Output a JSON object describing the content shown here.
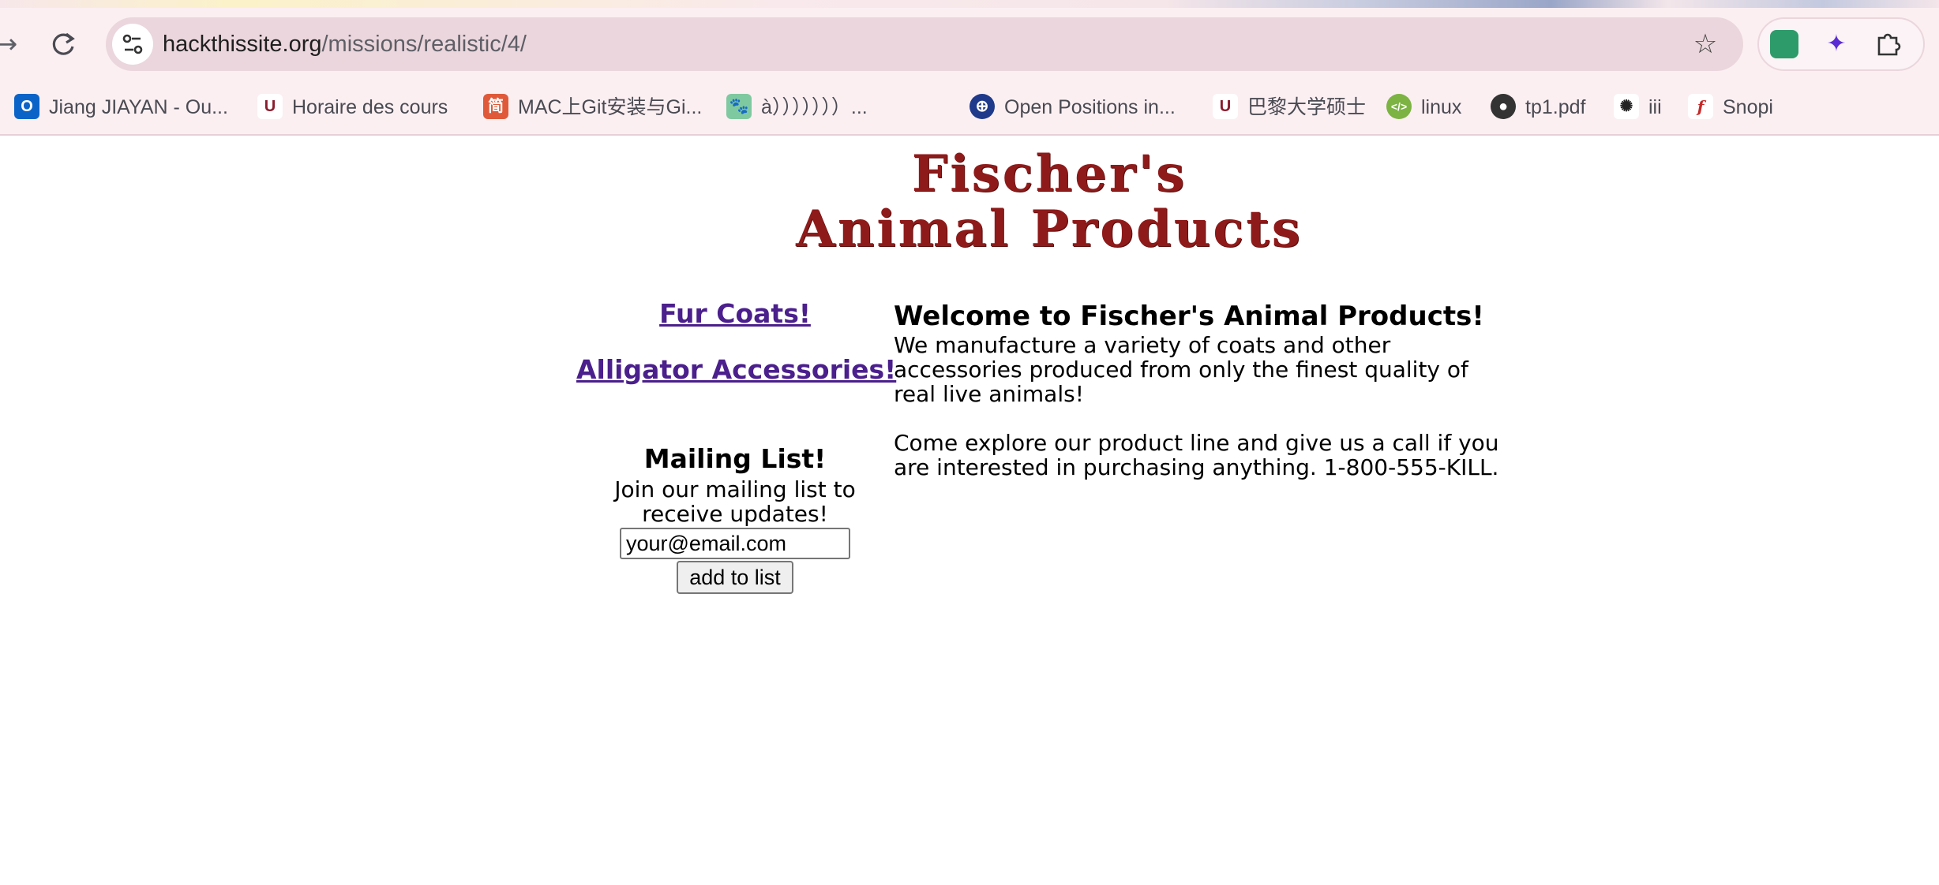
{
  "browser": {
    "url_host": "hackthissite.org",
    "url_path": "/missions/realistic/4/",
    "bookmarks": [
      {
        "label": "Jiang JIAYAN - Ou...",
        "icon": "outlook-icon",
        "color": "#0a64c8"
      },
      {
        "label": "Horaire des cours",
        "icon": "university-icon",
        "color": "#8a1c2c"
      },
      {
        "label": "MAC上Git安装与Gi...",
        "icon": "jianshu-icon",
        "color": "#e05a3a"
      },
      {
        "label": "à）））））））...",
        "icon": "paw-icon",
        "color": "#4caf7a"
      },
      {
        "label": "Open Positions in...",
        "icon": "globe-grid-icon",
        "color": "#1f3a8a"
      },
      {
        "label": "巴黎大学硕士",
        "icon": "university-icon",
        "color": "#8a1c2c"
      },
      {
        "label": "linux",
        "icon": "code-icon",
        "color": "#7cb342"
      },
      {
        "label": "tp1.pdf",
        "icon": "globe-icon",
        "color": "#333333"
      },
      {
        "label": "iii",
        "icon": "openai-icon",
        "color": "#222222"
      },
      {
        "label": "Snopi",
        "icon": "flash-icon",
        "color": "#c62828"
      }
    ]
  },
  "site": {
    "logo_line1": "Fischer's",
    "logo_line2": "Animal Products",
    "nav": [
      "Fur Coats!",
      "Alligator Accessories!"
    ],
    "mailing": {
      "title": "Mailing List!",
      "description": "Join our mailing list to receive updates!",
      "email_value": "your@email.com",
      "button": "add to list"
    },
    "main": {
      "heading": "Welcome to Fischer's Animal Products!",
      "paragraph1": "We manufacture a variety of coats and other accessories produced from only the finest quality of real live animals!",
      "paragraph2": "Come explore our product line and give us a call if you are interested in purchasing anything. 1-800-555-KILL."
    }
  }
}
